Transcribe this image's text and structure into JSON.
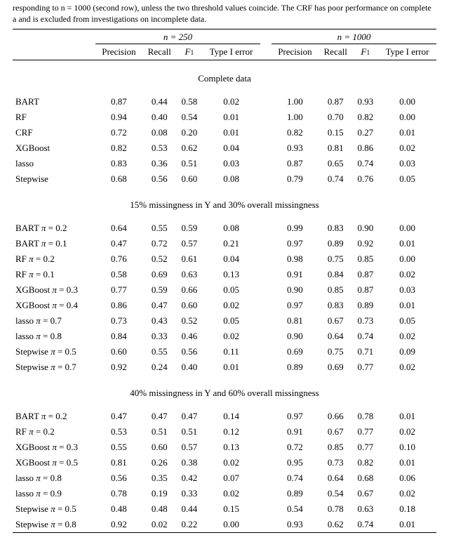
{
  "caption_l1": "responding to n = 1000 (second row), unless the two threshold values coincide. The CRF has poor performance on complete",
  "caption_l2": "a and is excluded from investigations on incomplete data.",
  "hdr": {
    "n250": "n = 250",
    "n1000": "n = 1000",
    "precision": "Precision",
    "recall": "Recall",
    "f1_a": "F",
    "f1_b": "1",
    "type1": "Type I error"
  },
  "sections": [
    {
      "title": "Complete data",
      "rows": [
        {
          "label": "BART",
          "a": [
            "0.87",
            "0.44",
            "0.58",
            "0.02"
          ],
          "b": [
            "1.00",
            "0.87",
            "0.93",
            "0.00"
          ]
        },
        {
          "label": "RF",
          "a": [
            "0.94",
            "0.40",
            "0.54",
            "0.01"
          ],
          "b": [
            "1.00",
            "0.70",
            "0.82",
            "0.00"
          ]
        },
        {
          "label": "CRF",
          "a": [
            "0.72",
            "0.08",
            "0.20",
            "0.01"
          ],
          "b": [
            "0.82",
            "0.15",
            "0.27",
            "0.01"
          ]
        },
        {
          "label": "XGBoost",
          "a": [
            "0.82",
            "0.53",
            "0.62",
            "0.04"
          ],
          "b": [
            "0.93",
            "0.81",
            "0.86",
            "0.02"
          ]
        },
        {
          "label": "lasso",
          "a": [
            "0.83",
            "0.36",
            "0.51",
            "0.03"
          ],
          "b": [
            "0.87",
            "0.65",
            "0.74",
            "0.03"
          ]
        },
        {
          "label": "Stepwise",
          "a": [
            "0.68",
            "0.56",
            "0.60",
            "0.08"
          ],
          "b": [
            "0.79",
            "0.74",
            "0.76",
            "0.05"
          ]
        }
      ]
    },
    {
      "title": "15% missingness in Y and 30% overall missingness",
      "rows": [
        {
          "label": "BART π = 0.2",
          "a": [
            "0.64",
            "0.55",
            "0.59",
            "0.08"
          ],
          "b": [
            "0.99",
            "0.83",
            "0.90",
            "0.00"
          ]
        },
        {
          "label": "BART π = 0.1",
          "a": [
            "0.47",
            "0.72",
            "0.57",
            "0.21"
          ],
          "b": [
            "0.97",
            "0.89",
            "0.92",
            "0.01"
          ]
        },
        {
          "label": "RF π = 0.2",
          "a": [
            "0.76",
            "0.52",
            "0.61",
            "0.04"
          ],
          "b": [
            "0.98",
            "0.75",
            "0.85",
            "0.00"
          ]
        },
        {
          "label": "RF π = 0.1",
          "a": [
            "0.58",
            "0.69",
            "0.63",
            "0.13"
          ],
          "b": [
            "0.91",
            "0.84",
            "0.87",
            "0.02"
          ]
        },
        {
          "label": "XGBoost π = 0.3",
          "a": [
            "0.77",
            "0.59",
            "0.66",
            "0.05"
          ],
          "b": [
            "0.90",
            "0.85",
            "0.87",
            "0.03"
          ]
        },
        {
          "label": "XGBoost π = 0.4",
          "a": [
            "0.86",
            "0.47",
            "0.60",
            "0.02"
          ],
          "b": [
            "0.97",
            "0.83",
            "0.89",
            "0.01"
          ]
        },
        {
          "label": "lasso π = 0.7",
          "a": [
            "0.73",
            "0.43",
            "0.52",
            "0.05"
          ],
          "b": [
            "0.81",
            "0.67",
            "0.73",
            "0.05"
          ]
        },
        {
          "label": "lasso π = 0.8",
          "a": [
            "0.84",
            "0.33",
            "0.46",
            "0.02"
          ],
          "b": [
            "0.90",
            "0.64",
            "0.74",
            "0.02"
          ]
        },
        {
          "label": "Stepwise π = 0.5",
          "a": [
            "0.60",
            "0.55",
            "0.56",
            "0.11"
          ],
          "b": [
            "0.69",
            "0.75",
            "0.71",
            "0.09"
          ]
        },
        {
          "label": "Stepwise π = 0.7",
          "a": [
            "0.92",
            "0.24",
            "0.40",
            "0.01"
          ],
          "b": [
            "0.89",
            "0.69",
            "0.77",
            "0.02"
          ]
        }
      ]
    },
    {
      "title": "40% missingness in Y and 60% overall missingness",
      "rows": [
        {
          "label": "BART π = 0.2",
          "a": [
            "0.47",
            "0.47",
            "0.47",
            "0.14"
          ],
          "b": [
            "0.97",
            "0.66",
            "0.78",
            "0.01"
          ]
        },
        {
          "label": "RF π = 0.2",
          "a": [
            "0.53",
            "0.51",
            "0.51",
            "0.12"
          ],
          "b": [
            "0.91",
            "0.67",
            "0.77",
            "0.02"
          ]
        },
        {
          "label": "XGBoost π = 0.3",
          "a": [
            "0.55",
            "0.60",
            "0.57",
            "0.13"
          ],
          "b": [
            "0.72",
            "0.85",
            "0.77",
            "0.10"
          ]
        },
        {
          "label": "XGBoost π = 0.5",
          "a": [
            "0.81",
            "0.26",
            "0.38",
            "0.02"
          ],
          "b": [
            "0.95",
            "0.73",
            "0.82",
            "0.01"
          ]
        },
        {
          "label": "lasso π = 0.8",
          "a": [
            "0.56",
            "0.35",
            "0.42",
            "0.07"
          ],
          "b": [
            "0.74",
            "0.64",
            "0.68",
            "0.06"
          ]
        },
        {
          "label": "lasso π = 0.9",
          "a": [
            "0.78",
            "0.19",
            "0.33",
            "0.02"
          ],
          "b": [
            "0.89",
            "0.54",
            "0.67",
            "0.02"
          ]
        },
        {
          "label": "Stepwise π = 0.5",
          "a": [
            "0.48",
            "0.48",
            "0.44",
            "0.15"
          ],
          "b": [
            "0.54",
            "0.78",
            "0.63",
            "0.18"
          ]
        },
        {
          "label": "Stepwise π = 0.8",
          "a": [
            "0.92",
            "0.02",
            "0.22",
            "0.00"
          ],
          "b": [
            "0.93",
            "0.62",
            "0.74",
            "0.01"
          ]
        }
      ]
    }
  ]
}
